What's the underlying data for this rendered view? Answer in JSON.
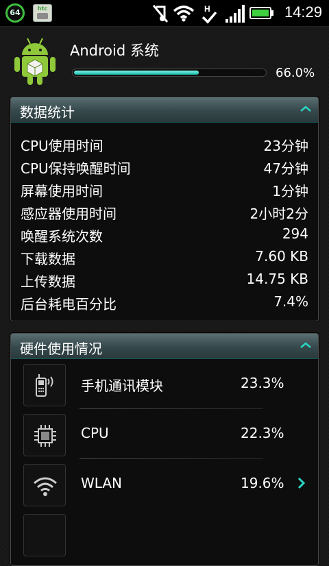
{
  "status_bar": {
    "badge": "64",
    "app_icon_text": "htc",
    "time": "14:29",
    "icons": [
      "notification-count-badge",
      "htc-app-icon",
      "music-muted-icon",
      "wifi-icon",
      "h-signal-icon",
      "cell-signal-icon",
      "battery-icon"
    ]
  },
  "header": {
    "app_name": "Android 系统",
    "progress_percent": 66.0,
    "progress_text": "66.0%"
  },
  "stats": {
    "title": "数据统计",
    "rows": [
      {
        "label": "CPU使用时间",
        "value": "23分钟"
      },
      {
        "label": "CPU保持唤醒时间",
        "value": "47分钟"
      },
      {
        "label": "屏幕使用时间",
        "value": "1分钟"
      },
      {
        "label": "感应器使用时间",
        "value": "2小时2分"
      },
      {
        "label": "唤醒系统次数",
        "value": "294"
      },
      {
        "label": "下载数据",
        "value": "7.60 KB"
      },
      {
        "label": "上传数据",
        "value": "14.75 KB"
      },
      {
        "label": "后台耗电百分比",
        "value": "7.4%"
      }
    ]
  },
  "hardware": {
    "title": "硬件使用情况",
    "items": [
      {
        "icon": "phone-radio-icon",
        "name": "手机通讯模块",
        "value": "23.3%"
      },
      {
        "icon": "cpu-chip-icon",
        "name": "CPU",
        "value": "22.3%"
      },
      {
        "icon": "wifi-icon",
        "name": "WLAN",
        "value": "19.6%"
      }
    ]
  },
  "colors": {
    "accent": "#2ad6c4",
    "panel_header": "#3d5052",
    "background": "#161616"
  }
}
